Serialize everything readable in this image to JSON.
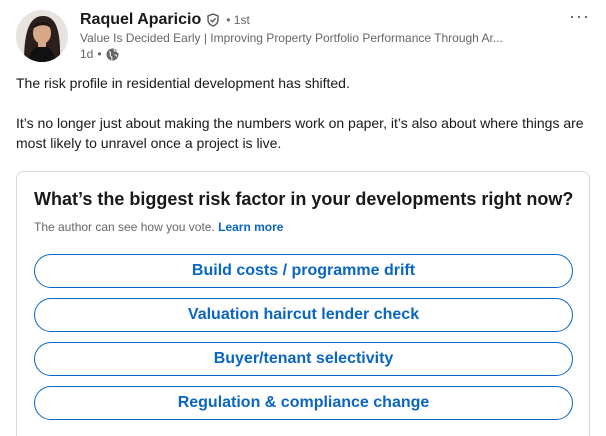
{
  "post": {
    "author": {
      "name": "Raquel Aparicio",
      "connection_degree": "1st",
      "headline": "Value Is Decided Early | Improving Property Portfolio Performance Through Ar...",
      "time_ago": "1d",
      "separator": "•",
      "visibility_icon": "globe-icon",
      "verified_icon": "verified-shield-icon"
    },
    "more_icon": "ellipsis-icon",
    "text": [
      "The risk profile in residential development has shifted.",
      "It’s no longer just about making the numbers work on paper, it’s also about where things are most likely to unravel once a project is live."
    ],
    "poll": {
      "question": "What’s the biggest risk factor in your developments right now?",
      "note": "The author can see how you vote.",
      "learn_more": "Learn more",
      "options": [
        "Build costs / programme drift",
        "Valuation haircut lender check",
        "Buyer/tenant selectivity",
        "Regulation & compliance change"
      ]
    }
  },
  "colors": {
    "accent": "#0a66c2",
    "text_primary": "#191919",
    "text_secondary": "#666666",
    "border": "#d9d9d9"
  }
}
